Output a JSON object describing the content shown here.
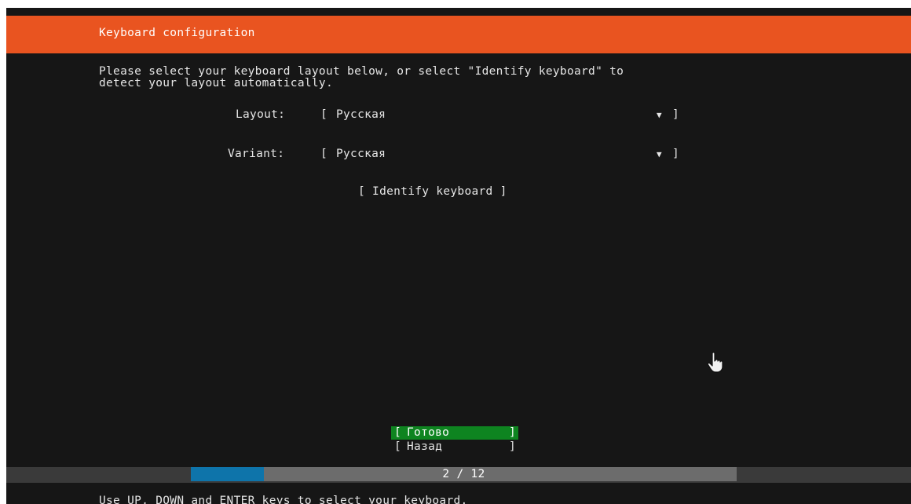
{
  "header": {
    "title": "Keyboard configuration"
  },
  "instructions": {
    "line1": "Please select your keyboard layout below, or select \"Identify keyboard\" to",
    "line2": "detect your layout automatically."
  },
  "layout_field": {
    "label": "Layout:",
    "value": "Русская",
    "bracket_open": "[",
    "bracket_close": "]",
    "arrow": "▼"
  },
  "variant_field": {
    "label": "Variant:",
    "value": "Русская",
    "bracket_open": "[",
    "bracket_close": "]",
    "arrow": "▼"
  },
  "identify_button": {
    "label": "[ Identify keyboard ]"
  },
  "buttons": {
    "done": {
      "label": "Готово",
      "bracket_open": "[",
      "bracket_close": "]"
    },
    "back": {
      "label": "Назад",
      "bracket_open": "[",
      "bracket_close": "]"
    }
  },
  "progress": {
    "text": "2 / 12",
    "current": 2,
    "total": 12
  },
  "hint": "Use UP, DOWN and ENTER keys to select your keyboard.",
  "colors": {
    "header_bg": "#e95420",
    "screen_bg": "#161616",
    "focus_bg": "#0e8420",
    "progress_fill": "#0e74aa"
  },
  "icons": {
    "cursor": "hand-pointer-icon"
  }
}
